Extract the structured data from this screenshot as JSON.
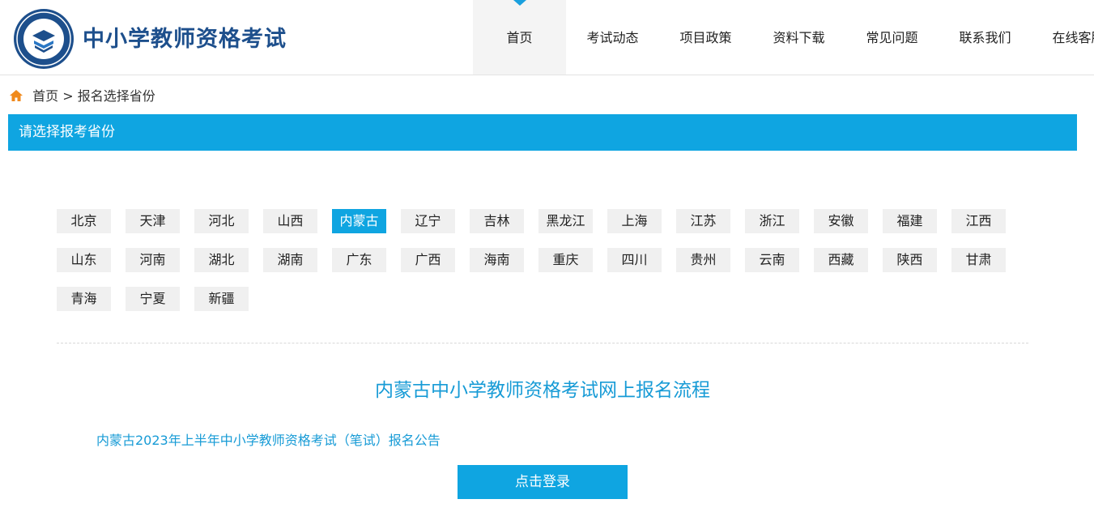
{
  "header": {
    "site_title": "中小学教师资格考试",
    "logo_icon": "teacher-exam-emblem-icon",
    "brand_color": "#1d4f8c",
    "accent_color": "#0fa5e1"
  },
  "nav": {
    "items": [
      {
        "label": "首页",
        "active": true
      },
      {
        "label": "考试动态"
      },
      {
        "label": "项目政策"
      },
      {
        "label": "资料下载"
      },
      {
        "label": "常见问题"
      },
      {
        "label": "联系我们"
      },
      {
        "label": "在线客服"
      }
    ]
  },
  "breadcrumb": {
    "home_icon": "home-icon",
    "home_label": "首页",
    "separator": ">",
    "current": "报名选择省份"
  },
  "section": {
    "title": "请选择报考省份"
  },
  "provinces": {
    "selected": "内蒙古",
    "items": [
      "北京",
      "天津",
      "河北",
      "山西",
      "内蒙古",
      "辽宁",
      "吉林",
      "黑龙江",
      "上海",
      "江苏",
      "浙江",
      "安徽",
      "福建",
      "江西",
      "山东",
      "河南",
      "湖北",
      "湖南",
      "广东",
      "广西",
      "海南",
      "重庆",
      "四川",
      "贵州",
      "云南",
      "西藏",
      "陕西",
      "甘肃",
      "青海",
      "宁夏",
      "新疆"
    ]
  },
  "content": {
    "flow_title": "内蒙古中小学教师资格考试网上报名流程",
    "notice_link": "内蒙古2023年上半年中小学教师资格考试（笔试）报名公告",
    "login_button": "点击登录"
  }
}
